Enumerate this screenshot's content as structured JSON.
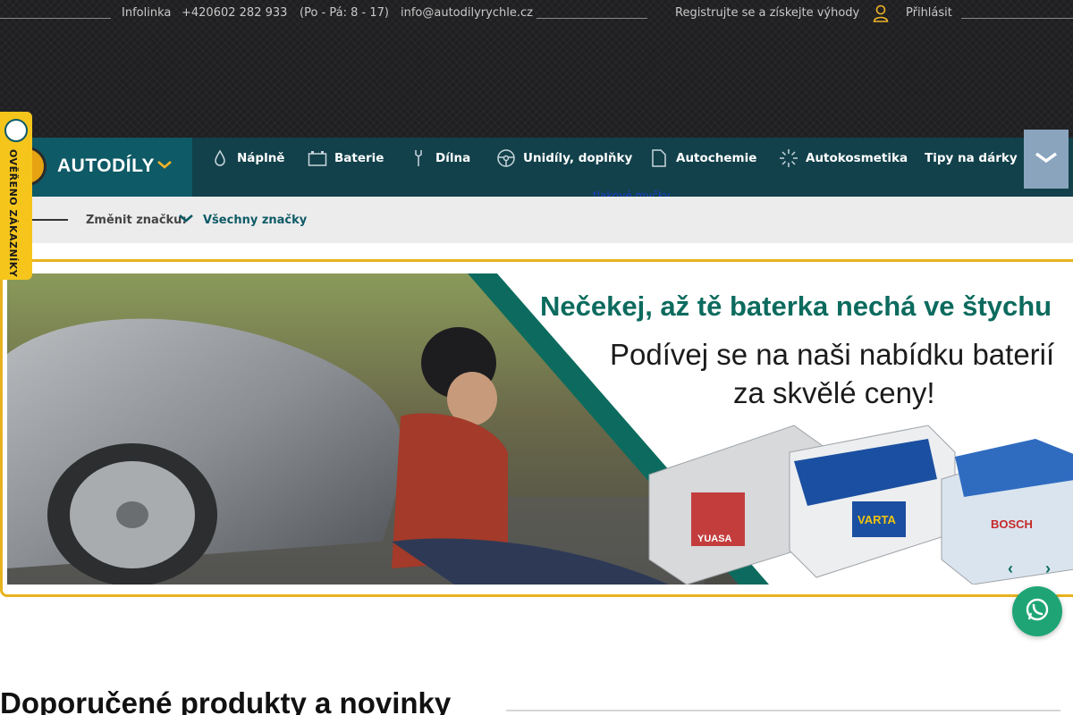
{
  "topbar": {
    "infoline_label": "Infolinka",
    "phone": "+420602 282 933",
    "hours": "(Po - Pá: 8 - 17)",
    "email": "info@autodilyrychle.cz",
    "register": "Registrujte se a získejte výhody",
    "login": "Přihlásit"
  },
  "verified": {
    "text": "OVĚŘENO ZÁKAZNÍKY"
  },
  "brand": {
    "label": "AUTODÍLY",
    "accent": "#f1b427"
  },
  "nav": {
    "items": [
      {
        "label": "Náplně",
        "icon": "droplet-icon"
      },
      {
        "label": "Baterie",
        "icon": "battery-icon"
      },
      {
        "label": "Dílna",
        "icon": "wrench-icon"
      },
      {
        "label": "Unidíly, doplňky",
        "icon": "steering-wheel-icon"
      },
      {
        "label": "Autochemie",
        "icon": "document-icon"
      },
      {
        "label": "Autokosmetika",
        "icon": "sparkle-icon"
      },
      {
        "label": "Tipy na dárky",
        "icon": ""
      }
    ],
    "sublink": "tlakové myčky"
  },
  "brandbar": {
    "label": "Změnit značku:",
    "value": "Všechny značky"
  },
  "banner": {
    "title": "Nečekej, až tě baterka nechá ve štychu",
    "subtitle_line1": "Podívej se na naši nabídku baterií",
    "subtitle_line2": "za skvělé ceny!",
    "batteries": [
      "YUASA",
      "VARTA",
      "BOSCH"
    ],
    "prev": "‹",
    "next": "›"
  },
  "section": {
    "title": "Doporučené produkty a novinky"
  },
  "colors": {
    "teal": "#0e5a66",
    "navy": "#12414b",
    "gold": "#e8b21f",
    "green": "#0c6b5e",
    "whatsapp": "#1fa575"
  }
}
